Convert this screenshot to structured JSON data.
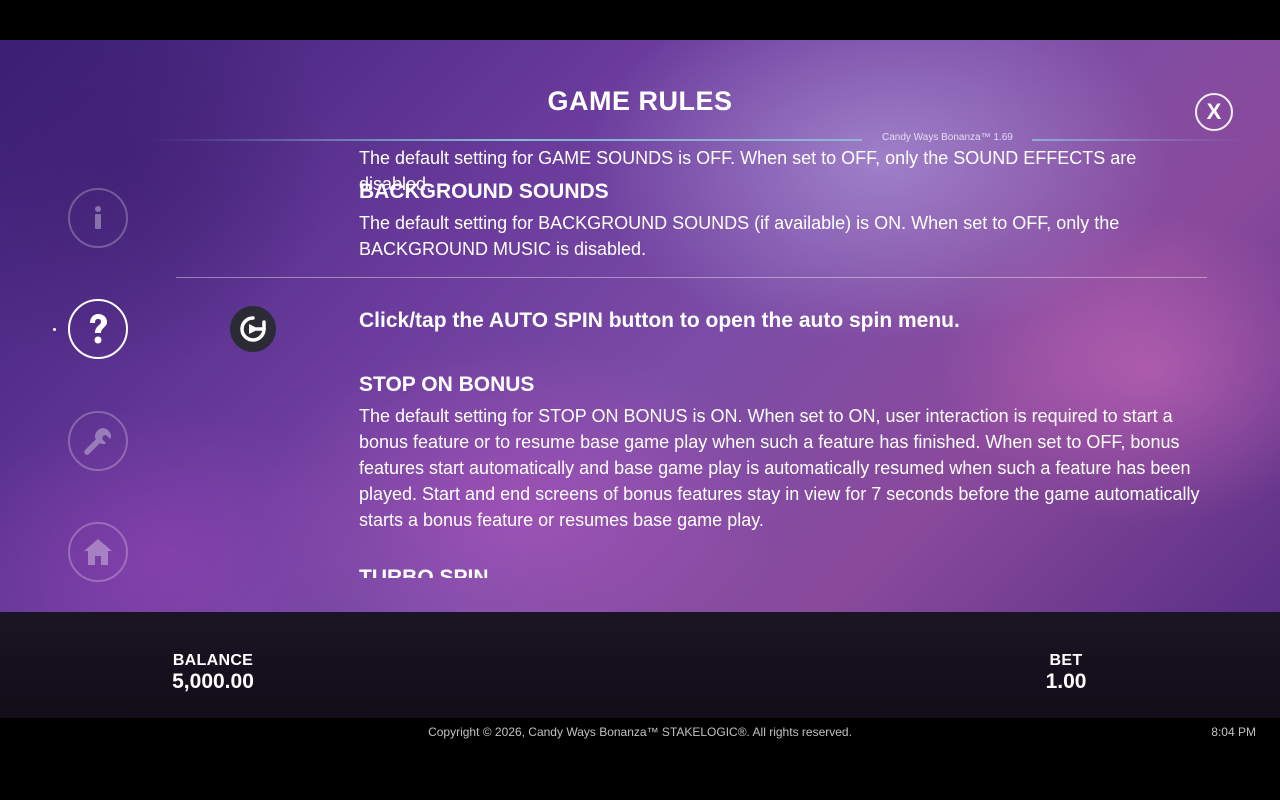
{
  "header": {
    "title": "GAME RULES",
    "close_label": "X",
    "version": "Candy Ways Bonanza™ 1.69"
  },
  "side_nav": {
    "items": [
      {
        "name": "info",
        "icon": "info-icon",
        "active": false
      },
      {
        "name": "help",
        "icon": "question-icon",
        "active": true
      },
      {
        "name": "settings",
        "icon": "wrench-icon",
        "active": false
      },
      {
        "name": "home",
        "icon": "home-icon",
        "active": false
      }
    ]
  },
  "content": {
    "cut_top_text": "The default setting for GAME SOUNDS is OFF. When set to OFF, only the SOUND EFFECTS are disabled.",
    "background_sounds_heading": "BACKGROUND SOUNDS",
    "background_sounds_text": "The default setting for BACKGROUND SOUNDS (if available) is ON. When set to OFF, only the BACKGROUND MUSIC is disabled.",
    "autospin_icon": "autospin-icon",
    "autospin_lead": "Click/tap the AUTO SPIN button to open the auto spin menu.",
    "stop_on_bonus_heading": "STOP ON BONUS",
    "stop_on_bonus_text": "The default setting for STOP ON BONUS is ON. When set to ON, user interaction is required to start a bonus feature or to resume base game play when such a feature has finished. When set to OFF, bonus features start automatically and base game play is automatically resumed when such a feature has been played. Start and end screens of bonus features stay in view for 7 seconds before the game automatically starts a bonus feature or resumes base game play.",
    "turbo_spin_heading": "TURBO SPIN"
  },
  "bottom_bar": {
    "balance_label": "BALANCE",
    "balance_value": "5,000.00",
    "bet_label": "BET",
    "bet_value": "1.00"
  },
  "footer": {
    "copyright": "Copyright © 2026, Candy Ways Bonanza™ STAKELOGIC®. All rights reserved.",
    "clock": "8:04 PM"
  }
}
